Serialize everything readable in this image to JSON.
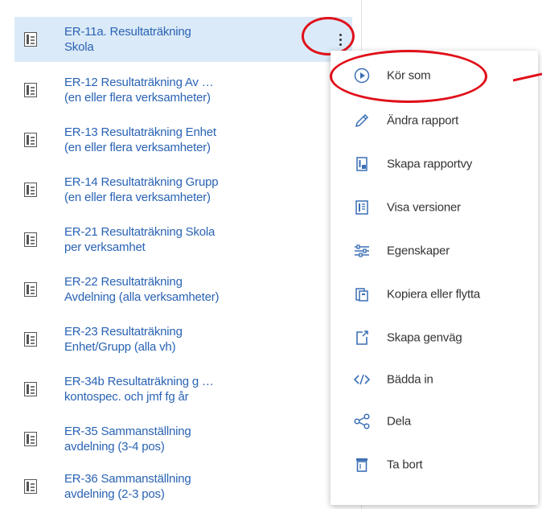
{
  "reports": [
    {
      "line1": "ER-11a. Resultaträkning",
      "line2": "Skola"
    },
    {
      "line1": "ER-12 Resultaträkning Av …",
      "line2": "(en eller flera verksamheter)"
    },
    {
      "line1": "ER-13 Resultaträkning Enhet",
      "line2": "(en eller flera verksamheter)"
    },
    {
      "line1": "ER-14 Resultaträkning Grupp",
      "line2": "(en eller flera verksamheter)"
    },
    {
      "line1": "ER-21 Resultaträkning Skola",
      "line2": "per verksamhet"
    },
    {
      "line1": "ER-22 Resultaträkning",
      "line2": "Avdelning (alla verksamheter)"
    },
    {
      "line1": "ER-23 Resultaträkning",
      "line2": "Enhet/Grupp (alla vh)"
    },
    {
      "line1": "ER-34b Resultaträkning g …",
      "line2": "kontospec. och jmf fg år"
    },
    {
      "line1": "ER-35 Sammanställning",
      "line2": "avdelning (3-4 pos)"
    },
    {
      "line1": "ER-36 Sammanställning",
      "line2": "avdelning (2-3 pos)"
    }
  ],
  "context_menu": [
    {
      "label": "Kör som",
      "icon": "run-icon"
    },
    {
      "label": "Ändra rapport",
      "icon": "pencil-icon"
    },
    {
      "label": "Skapa rapportvy",
      "icon": "report-view-icon"
    },
    {
      "label": "Visa versioner",
      "icon": "versions-icon"
    },
    {
      "label": "Egenskaper",
      "icon": "sliders-icon"
    },
    {
      "label": "Kopiera eller flytta",
      "icon": "copy-icon"
    },
    {
      "label": "Skapa genväg",
      "icon": "shortcut-icon"
    },
    {
      "label": "Bädda in",
      "icon": "code-icon"
    },
    {
      "label": "Dela",
      "icon": "share-icon"
    },
    {
      "label": "Ta bort",
      "icon": "trash-icon"
    }
  ],
  "colors": {
    "link_blue": "#2a63b4",
    "selected_bg": "#dbeaf8",
    "annotation_red": "#e0101a",
    "icon_blue": "#3b6fb6"
  }
}
